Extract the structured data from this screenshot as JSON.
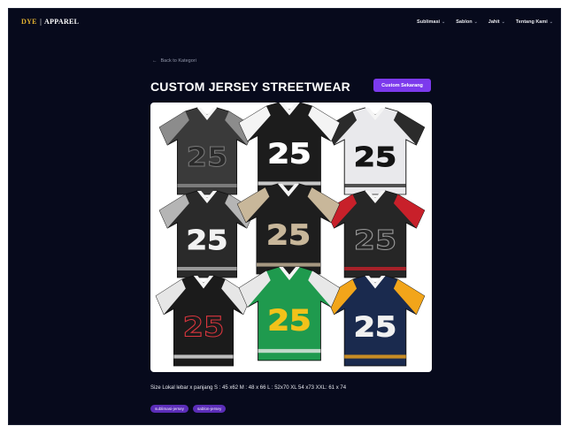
{
  "brand": {
    "part1": "DYE",
    "separator": "|",
    "part2": "APPAREL"
  },
  "nav": [
    {
      "label": "Sublimasi",
      "icon": "chevron-down-icon"
    },
    {
      "label": "Sablon",
      "icon": "chevron-down-icon"
    },
    {
      "label": "Jahit",
      "icon": "chevron-down-icon"
    },
    {
      "label": "Tentang Kami",
      "icon": "chevron-down-icon"
    }
  ],
  "back_link": {
    "icon": "arrow-left-icon",
    "label": "Back to Kategori"
  },
  "page_title": "CUSTOM JERSEY STREETWEAR",
  "cta_label": "Custom Sekarang",
  "product_image": {
    "description_icon": "jersey-collage-image",
    "jerseys": [
      {
        "number": "25",
        "shirt": "#3a3a3a",
        "panel": "#8c8c8c",
        "numcolor": "#2a2a2a",
        "numstroke": "#777777"
      },
      {
        "number": "25",
        "shirt": "#1c1c1c",
        "panel": "#f4f4f4",
        "numcolor": "#ffffff",
        "numstroke": "#ffffff"
      },
      {
        "number": "25",
        "shirt": "#e9e9ec",
        "panel": "#2b2b2b",
        "numcolor": "#141414",
        "numstroke": "#141414"
      },
      {
        "number": "25",
        "shirt": "#2a2a2a",
        "panel": "#b5b5b5",
        "numcolor": "#f2f2f2",
        "numstroke": "#f2f2f2"
      },
      {
        "number": "25",
        "shirt": "#1e1e1e",
        "panel": "#c8b79a",
        "numcolor": "#c8b79a",
        "numstroke": "#c8b79a"
      },
      {
        "number": "25",
        "shirt": "#262626",
        "panel": "#c8202a",
        "numcolor": "#262626",
        "numstroke": "#999999"
      },
      {
        "number": "25",
        "shirt": "#1b1b1b",
        "panel": "#e6e6e6",
        "numcolor": "#1b1b1b",
        "numstroke": "#d9363e"
      },
      {
        "number": "25",
        "shirt": "#1f9a4e",
        "panel": "#e8e8e8",
        "numcolor": "#f2c21a",
        "numstroke": "#f2c21a"
      },
      {
        "number": "25",
        "shirt": "#1a2a4e",
        "panel": "#f2a51a",
        "numcolor": "#f0f0f0",
        "numstroke": "#f0f0f0"
      }
    ]
  },
  "size_text": "Size Lokal lebar x panjang S : 45 x62 M : 48 x 66 L : 52x70 XL 54 x73 XXL: 61 x 74",
  "tags": [
    "sublimasi-jersey",
    "sablon-jersey"
  ],
  "colors": {
    "background": "#070a1c",
    "accent": "#7c3aed",
    "tag": "#5b2db8",
    "brand_accent": "#e0b030"
  }
}
